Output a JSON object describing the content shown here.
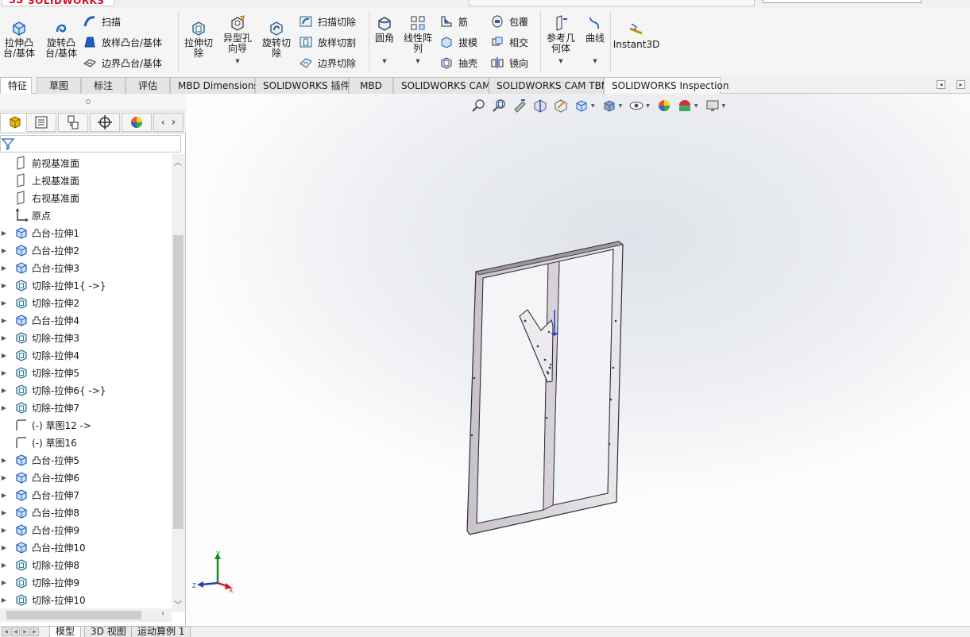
{
  "app": {
    "logo_prefix": "3S",
    "logo_text": "SOLIDWORKS"
  },
  "ribbon": {
    "extrude_boss": "拉伸凸\n台/基体",
    "revolve_boss": "旋转凸\n台/基体",
    "sweep": "扫描",
    "loft_boss": "放样凸台/基体",
    "boundary_boss": "边界凸台/基体",
    "extrude_cut": "拉伸切\n除",
    "hole_wizard": "异型孔\n向导",
    "revolve_cut": "旋转切\n除",
    "swept_cut": "扫描切除",
    "lofted_cut": "放样切割",
    "boundary_cut": "边界切除",
    "fillet": "圆角",
    "linear_pattern": "线性阵\n列",
    "rib": "筋",
    "draft": "拔模",
    "shell": "抽壳",
    "wrap": "包覆",
    "intersect": "相交",
    "mirror": "镜向",
    "ref_geometry": "参考几\n何体",
    "curves": "曲线",
    "instant3d": "Instant3D"
  },
  "tabs": [
    "特征",
    "草图",
    "标注",
    "评估",
    "MBD Dimensions",
    "SOLIDWORKS 插件",
    "MBD",
    "SOLIDWORKS CAM",
    "SOLIDWORKS CAM TBM",
    "SOLIDWORKS Inspection"
  ],
  "tree": [
    {
      "label": "前视基准面",
      "type": "plane",
      "expandable": false
    },
    {
      "label": "上视基准面",
      "type": "plane",
      "expandable": false
    },
    {
      "label": "右视基准面",
      "type": "plane",
      "expandable": false
    },
    {
      "label": "原点",
      "type": "origin",
      "expandable": false
    },
    {
      "label": "凸台-拉伸1",
      "type": "boss",
      "expandable": true
    },
    {
      "label": "凸台-拉伸2",
      "type": "boss",
      "expandable": true
    },
    {
      "label": "凸台-拉伸3",
      "type": "boss",
      "expandable": true
    },
    {
      "label": "切除-拉伸1{ ->}",
      "type": "cut",
      "expandable": true
    },
    {
      "label": "切除-拉伸2",
      "type": "cut",
      "expandable": true
    },
    {
      "label": "凸台-拉伸4",
      "type": "boss",
      "expandable": true
    },
    {
      "label": "切除-拉伸3",
      "type": "cut",
      "expandable": true
    },
    {
      "label": "切除-拉伸4",
      "type": "cut",
      "expandable": true
    },
    {
      "label": "切除-拉伸5",
      "type": "cut",
      "expandable": true
    },
    {
      "label": "切除-拉伸6{ ->}",
      "type": "cut",
      "expandable": true
    },
    {
      "label": "切除-拉伸7",
      "type": "cut",
      "expandable": true
    },
    {
      "label": "(-) 草图12 ->",
      "type": "sketch",
      "expandable": false
    },
    {
      "label": "(-) 草图16",
      "type": "sketch",
      "expandable": false
    },
    {
      "label": "凸台-拉伸5",
      "type": "boss",
      "expandable": true
    },
    {
      "label": "凸台-拉伸6",
      "type": "boss",
      "expandable": true
    },
    {
      "label": "凸台-拉伸7",
      "type": "boss",
      "expandable": true
    },
    {
      "label": "凸台-拉伸8",
      "type": "boss",
      "expandable": true
    },
    {
      "label": "凸台-拉伸9",
      "type": "boss",
      "expandable": true
    },
    {
      "label": "凸台-拉伸10",
      "type": "boss",
      "expandable": true
    },
    {
      "label": "切除-拉伸8",
      "type": "cut",
      "expandable": true
    },
    {
      "label": "切除-拉伸9",
      "type": "cut",
      "expandable": true
    },
    {
      "label": "切除-拉伸10",
      "type": "cut",
      "expandable": true
    }
  ],
  "triad": {
    "x": "X",
    "y": "Y",
    "z": "Z"
  },
  "bottom_tabs": [
    "模型",
    "3D 视图",
    "运动算例 1"
  ],
  "colors": {
    "accent_blue": "#1f5fbf",
    "cut_teal": "#2b8a8a",
    "logo_red": "#d0102b",
    "part_edge": "#3a3a48",
    "part_face": "#dcd6dc"
  },
  "icons": [
    "zoom-to-fit-icon",
    "zoom-area-icon",
    "previous-view-icon",
    "section-view-icon",
    "dynamic-annotation-icon",
    "view-orientation-icon",
    "display-style-icon",
    "hide-show-icon",
    "edit-appearance-icon",
    "apply-scene-icon",
    "view-settings-icon"
  ]
}
